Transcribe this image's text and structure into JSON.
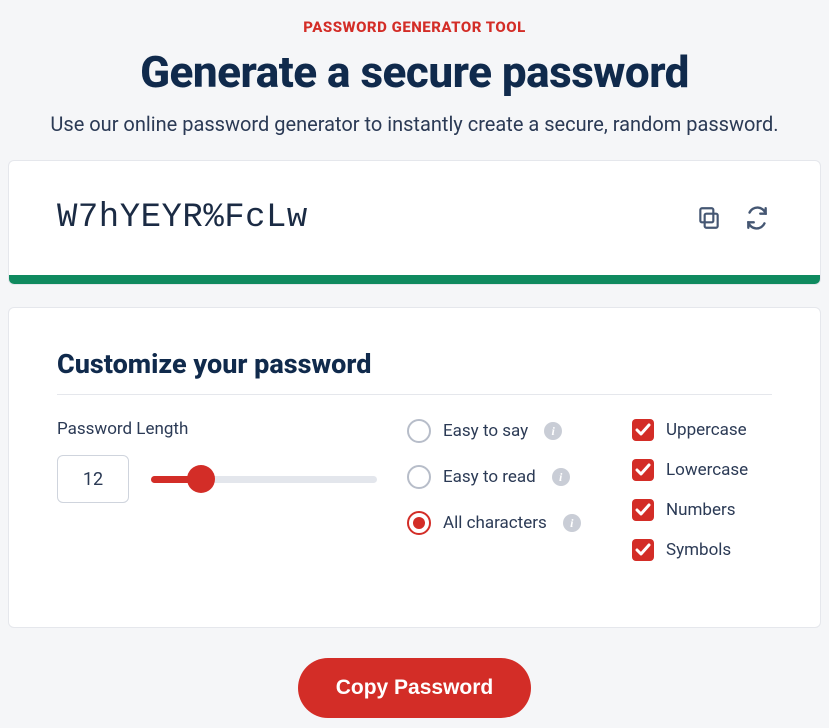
{
  "eyebrow": "PASSWORD GENERATOR TOOL",
  "title": "Generate a secure password",
  "subtitle": "Use our online password generator to instantly create a secure, random password.",
  "password": "W7hYEYR%FcLw",
  "customize": {
    "heading": "Customize your password",
    "length_label": "Password Length",
    "length_value": "12",
    "options": {
      "easy_say": "Easy to say",
      "easy_read": "Easy to read",
      "all_chars": "All characters",
      "selected": "all_chars"
    },
    "includes": {
      "uppercase": "Uppercase",
      "lowercase": "Lowercase",
      "numbers": "Numbers",
      "symbols": "Symbols"
    }
  },
  "copy_button": "Copy Password",
  "colors": {
    "accent": "#d32d27",
    "strength": "#0f8a5f"
  }
}
